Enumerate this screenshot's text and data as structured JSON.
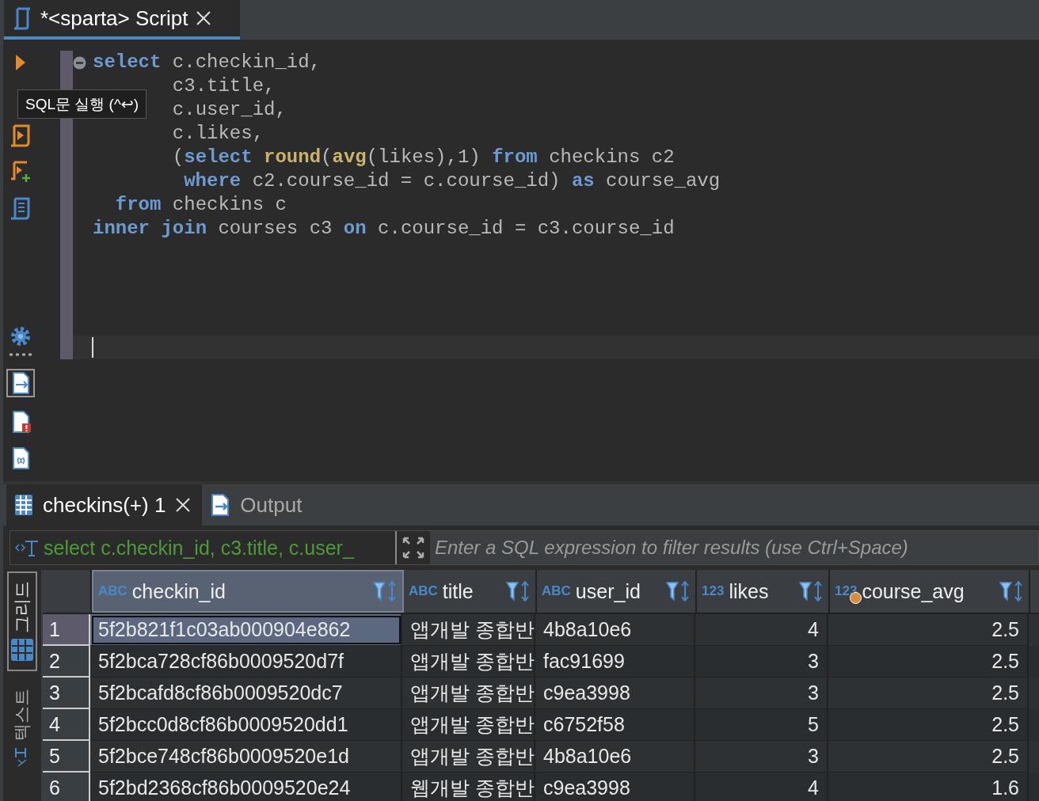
{
  "editor_tab": {
    "title": "*<sparta> Script",
    "selected": true
  },
  "tooltip": "SQL문 실행 (^↩)",
  "code_lines": [
    {
      "fold": true,
      "tokens": [
        {
          "kind": "keyword",
          "text": "select"
        },
        {
          "kind": "plain",
          "text": " c.checkin_id,"
        }
      ]
    },
    {
      "fold": false,
      "tokens": [
        {
          "kind": "plain",
          "text": "       c3.title,"
        }
      ]
    },
    {
      "fold": false,
      "tokens": [
        {
          "kind": "plain",
          "text": "       c.user_id,"
        }
      ]
    },
    {
      "fold": false,
      "tokens": [
        {
          "kind": "plain",
          "text": "       c.likes,"
        }
      ]
    },
    {
      "fold": false,
      "tokens": [
        {
          "kind": "plain",
          "text": "       ("
        },
        {
          "kind": "keyword",
          "text": "select"
        },
        {
          "kind": "function",
          "text": " round"
        },
        {
          "kind": "plain",
          "text": "("
        },
        {
          "kind": "function",
          "text": "avg"
        },
        {
          "kind": "plain",
          "text": "(likes),1) "
        },
        {
          "kind": "keyword",
          "text": "from"
        },
        {
          "kind": "plain",
          "text": " checkins c2"
        }
      ]
    },
    {
      "fold": false,
      "tokens": [
        {
          "kind": "keyword",
          "text": "        where"
        },
        {
          "kind": "plain",
          "text": " c2.course_id = c.course_id) "
        },
        {
          "kind": "keyword",
          "text": "as"
        },
        {
          "kind": "plain",
          "text": " course_avg"
        }
      ]
    },
    {
      "fold": false,
      "tokens": [
        {
          "kind": "keyword",
          "text": "  from"
        },
        {
          "kind": "plain",
          "text": " checkins c"
        }
      ]
    },
    {
      "fold": false,
      "tokens": [
        {
          "kind": "keyword",
          "text": "inner"
        },
        {
          "kind": "keyword",
          "text": " join"
        },
        {
          "kind": "plain",
          "text": " courses c3 "
        },
        {
          "kind": "keyword",
          "text": "on"
        },
        {
          "kind": "plain",
          "text": " c.course_id = c3.course_id"
        }
      ]
    }
  ],
  "result_tabs": [
    {
      "label": "checkins(+) 1",
      "kind": "grid",
      "selected": true,
      "closable": true
    },
    {
      "label": "Output",
      "kind": "output",
      "selected": false,
      "closable": false
    }
  ],
  "filter": {
    "query": "select c.checkin_id, c3.title, c.user_",
    "placeholder": "Enter a SQL expression to filter results (use Ctrl+Space)"
  },
  "view_tabs": [
    {
      "label": "그리드",
      "kind": "grid",
      "selected": true
    },
    {
      "label": "텍스트",
      "kind": "text",
      "selected": false
    }
  ],
  "table": {
    "columns": [
      {
        "name": "checkin_id",
        "type": "ABC",
        "kind": "text",
        "selected": true,
        "dot": false
      },
      {
        "name": "title",
        "type": "ABC",
        "kind": "text",
        "selected": false,
        "dot": false
      },
      {
        "name": "user_id",
        "type": "ABC",
        "kind": "text",
        "selected": false,
        "dot": false
      },
      {
        "name": "likes",
        "type": "123",
        "kind": "number",
        "selected": false,
        "dot": false
      },
      {
        "name": "course_avg",
        "type": "123",
        "kind": "number",
        "selected": false,
        "dot": true
      }
    ],
    "rows": [
      {
        "index": "1",
        "selected": true,
        "cells": [
          "5f2b821f1c03ab000904e862",
          "앱개발 종합반",
          "4b8a10e6",
          "4",
          "2.5"
        ]
      },
      {
        "index": "2",
        "selected": false,
        "cells": [
          "5f2bca728cf86b0009520d7f",
          "앱개발 종합반",
          "fac91699",
          "3",
          "2.5"
        ]
      },
      {
        "index": "3",
        "selected": false,
        "cells": [
          "5f2bcafd8cf86b0009520dc7",
          "앱개발 종합반",
          "c9ea3998",
          "3",
          "2.5"
        ]
      },
      {
        "index": "4",
        "selected": false,
        "cells": [
          "5f2bcc0d8cf86b0009520dd1",
          "앱개발 종합반",
          "c6752f58",
          "5",
          "2.5"
        ]
      },
      {
        "index": "5",
        "selected": false,
        "cells": [
          "5f2bce748cf86b0009520e1d",
          "앱개발 종합반",
          "4b8a10e6",
          "3",
          "2.5"
        ]
      },
      {
        "index": "6",
        "selected": false,
        "cells": [
          "5f2bd2368cf86b0009520e24",
          "웹개발 종합반",
          "c9ea3998",
          "4",
          "1.6"
        ]
      }
    ]
  }
}
